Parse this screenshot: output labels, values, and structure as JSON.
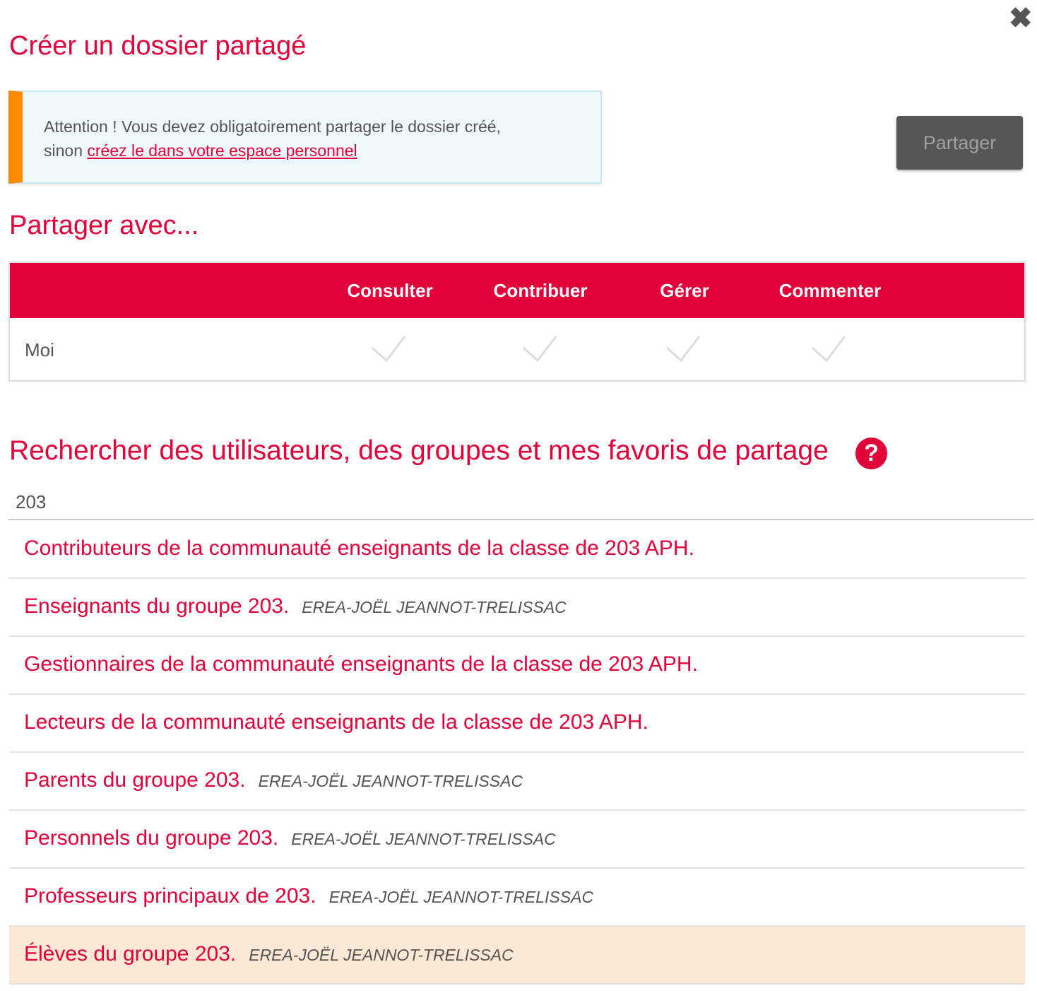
{
  "dialog": {
    "title": "Créer un dossier partagé",
    "close_icon": "close-icon"
  },
  "alert": {
    "text": "Attention ! Vous devez obligatoirement partager le dossier créé,",
    "text2": "sinon",
    "link": "créez le dans votre espace personnel"
  },
  "share_button": "Partager",
  "share_with": {
    "title": "Partager avec...",
    "columns": [
      "Consulter",
      "Contribuer",
      "Gérer",
      "Commenter"
    ],
    "rows": [
      {
        "name": "Moi",
        "checked": [
          true,
          true,
          true,
          true
        ]
      }
    ]
  },
  "search": {
    "title": "Rechercher des utilisateurs, des groupes et mes favoris de partage",
    "help_icon": "?",
    "value": "203",
    "results": [
      {
        "label": "Contributeurs de la communauté enseignants de la classe de 203 APH.",
        "structure": ""
      },
      {
        "label": "Enseignants du groupe 203.",
        "structure": "EREA-JOËL JEANNOT-TRELISSAC"
      },
      {
        "label": "Gestionnaires de la communauté enseignants de la classe de 203 APH.",
        "structure": ""
      },
      {
        "label": "Lecteurs de la communauté enseignants de la classe de 203 APH.",
        "structure": ""
      },
      {
        "label": "Parents du groupe 203.",
        "structure": "EREA-JOËL JEANNOT-TRELISSAC"
      },
      {
        "label": "Personnels du groupe 203.",
        "structure": "EREA-JOËL JEANNOT-TRELISSAC"
      },
      {
        "label": "Professeurs principaux de 203.",
        "structure": "EREA-JOËL JEANNOT-TRELISSAC"
      },
      {
        "label": "Élèves du groupe 203.",
        "structure": "EREA-JOËL JEANNOT-TRELISSAC",
        "highlighted": true
      }
    ]
  },
  "colors": {
    "accent": "#e2003a",
    "warning": "#ff8a00",
    "highlight": "#fde8d6"
  }
}
